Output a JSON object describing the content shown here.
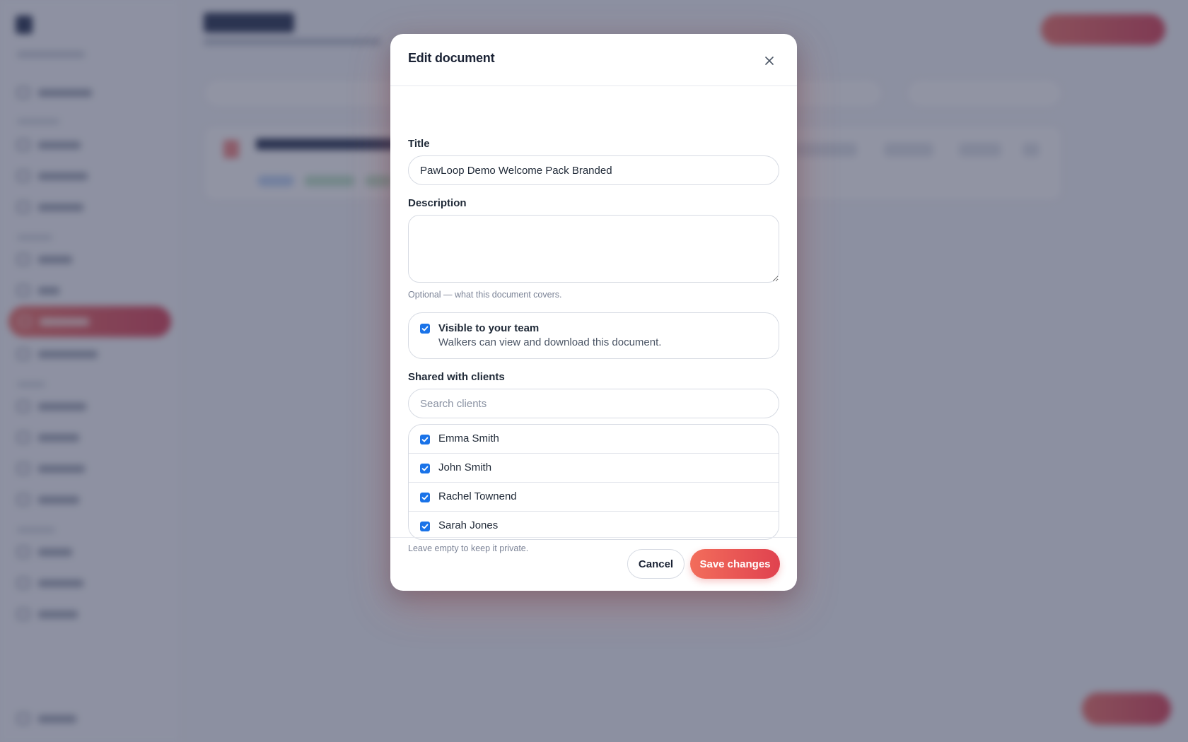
{
  "modal": {
    "title": "Edit document",
    "title_label": "Title",
    "title_value": "PawLoop Demo Welcome Pack Branded",
    "description_label": "Description",
    "description_value": "",
    "description_hint": "Optional — what this document covers.",
    "team_visibility": {
      "checked": true,
      "title": "Visible to your team",
      "description": "Walkers can view and download this document."
    },
    "shared_label": "Shared with clients",
    "search_placeholder": "Search clients",
    "clients": [
      {
        "name": "Emma Smith",
        "checked": true
      },
      {
        "name": "John Smith",
        "checked": true
      },
      {
        "name": "Rachel Townend",
        "checked": true
      },
      {
        "name": "Sarah Jones",
        "checked": true
      }
    ],
    "shared_hint": "Leave empty to keep it private.",
    "cancel_label": "Cancel",
    "save_label": "Save changes"
  },
  "colors": {
    "accent": "#ef5a55",
    "checkbox": "#1a73e8",
    "overlay": "#363c58"
  },
  "icons": {
    "close": "close-icon",
    "check": "check-icon"
  }
}
